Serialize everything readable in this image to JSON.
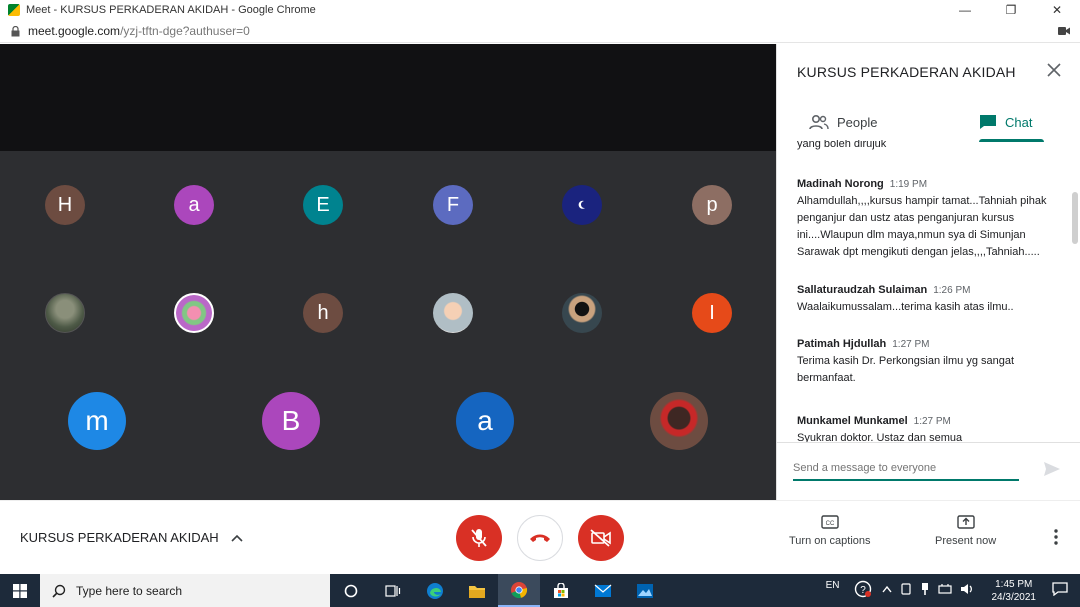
{
  "browser": {
    "window_title": "Meet - KURSUS PERKADERAN AKIDAH - Google Chrome",
    "url_host": "meet.google.com",
    "url_path": "/yzj-tftn-dge?authuser=0"
  },
  "participants": [
    {
      "initial": "H",
      "color": "#6d4c41"
    },
    {
      "initial": "a",
      "color": "#ab47bc"
    },
    {
      "initial": "E",
      "color": "#00838f"
    },
    {
      "initial": "F",
      "color": "#5c6bc0"
    },
    {
      "initial": "",
      "color": "#1a237e"
    },
    {
      "initial": "p",
      "color": "#8d6e63"
    },
    {
      "initial": "",
      "color": "#556b4d"
    },
    {
      "initial": "",
      "color": "#d81b60"
    },
    {
      "initial": "h",
      "color": "#6d4c41"
    },
    {
      "initial": "",
      "color": "#9e9e9e"
    },
    {
      "initial": "",
      "color": "#607d8b"
    },
    {
      "initial": "I",
      "color": "#e64a19"
    },
    {
      "initial": "m",
      "color": "#1e88e5"
    },
    {
      "initial": "B",
      "color": "#ab47bc"
    },
    {
      "initial": "a",
      "color": "#1565c0"
    },
    {
      "initial": "",
      "color": "#4e342e"
    }
  ],
  "panel": {
    "title": "KURSUS PERKADERAN AKIDAH",
    "tabs": {
      "people": "People",
      "chat": "Chat"
    },
    "messages": [
      {
        "sender": "",
        "time": "",
        "text": "yang boleh dirujuk"
      },
      {
        "sender": "Madinah Norong",
        "time": "1:19 PM",
        "text": "Alhamdullah,,,,kursus hampir tamat...Tahniah pihak penganjur dan ustz atas penganjuran kursus ini....Wlaupun dlm maya,nmun sya di Simunjan Sarawak dpt mengikuti dengan jelas,,,,Tahniah....."
      },
      {
        "sender": "Sallaturaudzah Sulaiman",
        "time": "1:26 PM",
        "text": "Waalaikumussalam...terima kasih atas ilmu.."
      },
      {
        "sender": "Patimah Hjdullah",
        "time": "1:27 PM",
        "text": "Terima kasih Dr. Perkongsian ilmu yg sangat bermanfaat."
      },
      {
        "sender": "Munkamel Munkamel",
        "time": "1:27 PM",
        "text": "Syukran doktor. Ustaz dan semua"
      }
    ],
    "composer_placeholder": "Send a message to everyone"
  },
  "controls": {
    "meeting_name": "KURSUS PERKADERAN AKIDAH",
    "captions_label": "Turn on captions",
    "present_label": "Present now"
  },
  "taskbar": {
    "search_placeholder": "Type here to search",
    "language": "EN",
    "time": "1:45 PM",
    "date": "24/3/2021"
  }
}
